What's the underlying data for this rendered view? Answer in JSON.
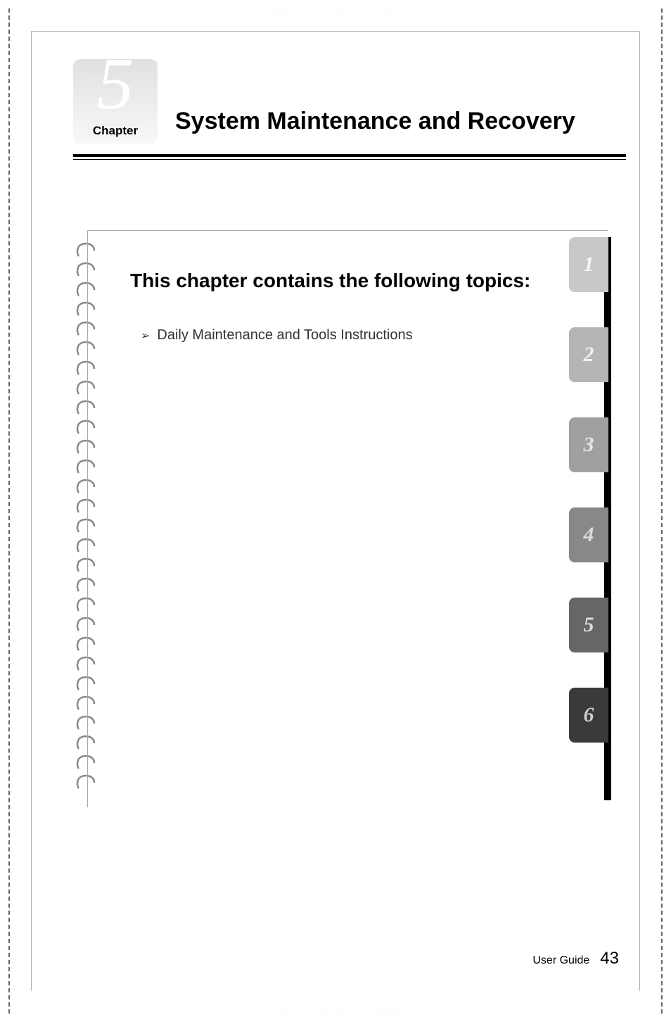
{
  "chapter": {
    "number": "5",
    "label": "Chapter",
    "title": "System Maintenance and Recovery"
  },
  "topics": {
    "heading": "This chapter contains the following topics:",
    "items": [
      "Daily Maintenance and Tools Instructions"
    ]
  },
  "tabs": [
    "1",
    "2",
    "3",
    "4",
    "5",
    "6"
  ],
  "footer": {
    "label": "User Guide",
    "page": "43"
  }
}
